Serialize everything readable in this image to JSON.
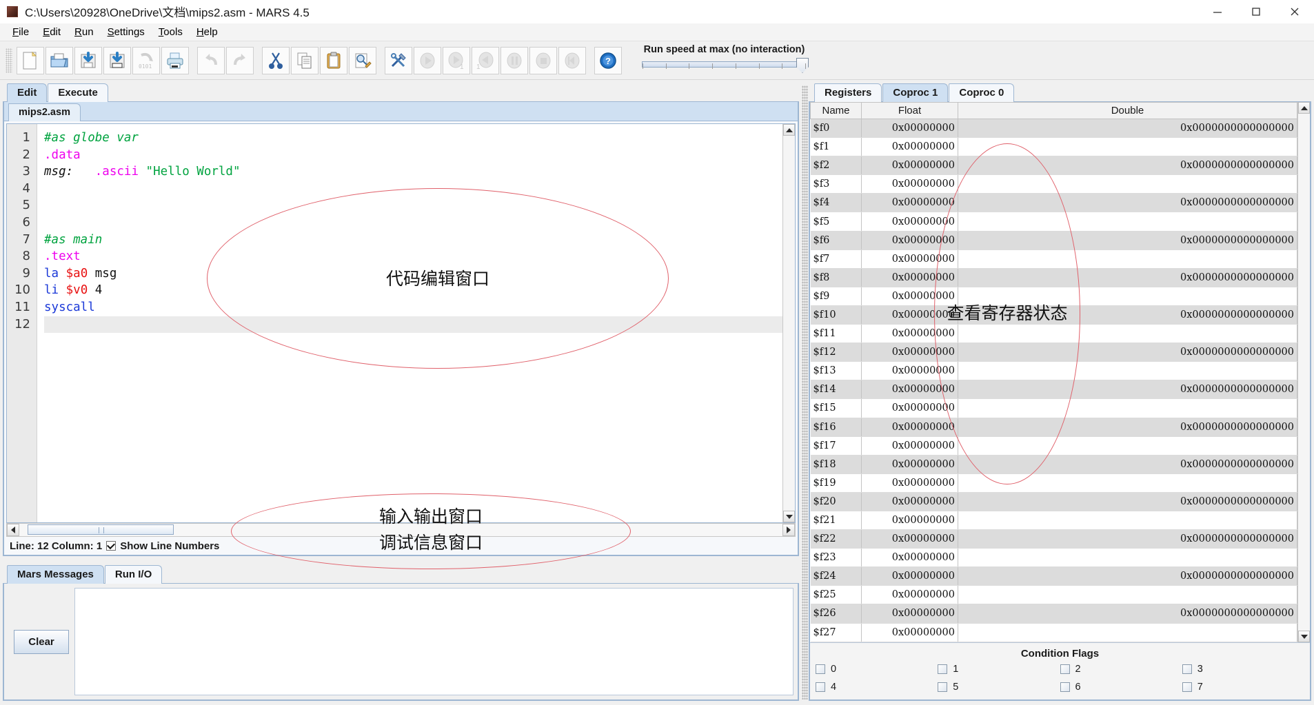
{
  "window": {
    "title": "C:\\Users\\20928\\OneDrive\\文档\\mips2.asm  - MARS 4.5",
    "minimize": "—",
    "maximize": "▢",
    "close": "✕"
  },
  "menu": [
    {
      "label": "File",
      "mnemonic": "F"
    },
    {
      "label": "Edit",
      "mnemonic": "E"
    },
    {
      "label": "Run",
      "mnemonic": "R"
    },
    {
      "label": "Settings",
      "mnemonic": "S"
    },
    {
      "label": "Tools",
      "mnemonic": "T"
    },
    {
      "label": "Help",
      "mnemonic": "H"
    }
  ],
  "toolbar": {
    "buttons": [
      {
        "name": "new-file-icon",
        "enabled": true
      },
      {
        "name": "open-file-icon",
        "enabled": true
      },
      {
        "name": "save-file-icon",
        "enabled": true
      },
      {
        "name": "save-as-file-icon",
        "enabled": true
      },
      {
        "name": "dump-memory-icon",
        "enabled": false
      },
      {
        "name": "print-icon",
        "enabled": true
      },
      {
        "name": "undo-icon",
        "enabled": false
      },
      {
        "name": "redo-icon",
        "enabled": false
      },
      {
        "name": "cut-icon",
        "enabled": true
      },
      {
        "name": "copy-icon",
        "enabled": true
      },
      {
        "name": "paste-icon",
        "enabled": true
      },
      {
        "name": "find-replace-icon",
        "enabled": true
      },
      {
        "name": "assemble-icon",
        "enabled": true
      },
      {
        "name": "run-icon",
        "enabled": false
      },
      {
        "name": "step-icon",
        "enabled": false
      },
      {
        "name": "backstep-icon",
        "enabled": false
      },
      {
        "name": "pause-icon",
        "enabled": false
      },
      {
        "name": "stop-icon",
        "enabled": false
      },
      {
        "name": "reset-icon",
        "enabled": false
      },
      {
        "name": "help-icon",
        "enabled": true
      }
    ],
    "run_speed_label": "Run speed at max (no interaction)"
  },
  "editor": {
    "tabs": [
      {
        "label": "Edit",
        "active": true
      },
      {
        "label": "Execute",
        "active": false
      }
    ],
    "file_tab": "mips2.asm",
    "lines": [
      {
        "num": "1",
        "tokens": [
          {
            "t": "#as globe var",
            "c": "c-comment"
          }
        ]
      },
      {
        "num": "2",
        "tokens": [
          {
            "t": ".data",
            "c": "c-directive"
          }
        ]
      },
      {
        "num": "3",
        "tokens": [
          {
            "t": "msg:",
            "c": "c-label"
          },
          {
            "t": "   ",
            "c": "c-plain"
          },
          {
            "t": ".ascii",
            "c": "c-directive"
          },
          {
            "t": " ",
            "c": "c-plain"
          },
          {
            "t": "\"Hello World\"",
            "c": "c-string"
          }
        ]
      },
      {
        "num": "4",
        "tokens": []
      },
      {
        "num": "5",
        "tokens": []
      },
      {
        "num": "6",
        "tokens": []
      },
      {
        "num": "7",
        "tokens": [
          {
            "t": "#as main",
            "c": "c-comment"
          }
        ]
      },
      {
        "num": "8",
        "tokens": [
          {
            "t": ".text",
            "c": "c-directive"
          }
        ]
      },
      {
        "num": "9",
        "tokens": [
          {
            "t": "la",
            "c": "c-instr"
          },
          {
            "t": " ",
            "c": "c-plain"
          },
          {
            "t": "$a0",
            "c": "c-reg"
          },
          {
            "t": " msg",
            "c": "c-plain"
          }
        ]
      },
      {
        "num": "10",
        "tokens": [
          {
            "t": "li",
            "c": "c-instr"
          },
          {
            "t": " ",
            "c": "c-plain"
          },
          {
            "t": "$v0",
            "c": "c-reg"
          },
          {
            "t": " 4",
            "c": "c-plain"
          }
        ]
      },
      {
        "num": "11",
        "tokens": [
          {
            "t": "syscall",
            "c": "c-instr"
          }
        ]
      },
      {
        "num": "12",
        "tokens": [],
        "current": true
      }
    ],
    "status": {
      "position": "Line: 12 Column: 1",
      "show_line_numbers_label": "Show Line Numbers",
      "show_line_numbers_checked": true
    }
  },
  "messages": {
    "tabs": [
      {
        "label": "Mars Messages",
        "active": true
      },
      {
        "label": "Run I/O",
        "active": false
      }
    ],
    "clear_label": "Clear",
    "content": ""
  },
  "registers": {
    "tabs": [
      {
        "label": "Registers",
        "active": false
      },
      {
        "label": "Coproc 1",
        "active": true
      },
      {
        "label": "Coproc 0",
        "active": false
      }
    ],
    "columns": [
      "Name",
      "Float",
      "Double"
    ],
    "rows": [
      {
        "name": "$f0",
        "float": "0x00000000",
        "double": "0x0000000000000000"
      },
      {
        "name": "$f1",
        "float": "0x00000000",
        "double": ""
      },
      {
        "name": "$f2",
        "float": "0x00000000",
        "double": "0x0000000000000000"
      },
      {
        "name": "$f3",
        "float": "0x00000000",
        "double": ""
      },
      {
        "name": "$f4",
        "float": "0x00000000",
        "double": "0x0000000000000000"
      },
      {
        "name": "$f5",
        "float": "0x00000000",
        "double": ""
      },
      {
        "name": "$f6",
        "float": "0x00000000",
        "double": "0x0000000000000000"
      },
      {
        "name": "$f7",
        "float": "0x00000000",
        "double": ""
      },
      {
        "name": "$f8",
        "float": "0x00000000",
        "double": "0x0000000000000000"
      },
      {
        "name": "$f9",
        "float": "0x00000000",
        "double": ""
      },
      {
        "name": "$f10",
        "float": "0x00000000",
        "double": "0x0000000000000000"
      },
      {
        "name": "$f11",
        "float": "0x00000000",
        "double": ""
      },
      {
        "name": "$f12",
        "float": "0x00000000",
        "double": "0x0000000000000000"
      },
      {
        "name": "$f13",
        "float": "0x00000000",
        "double": ""
      },
      {
        "name": "$f14",
        "float": "0x00000000",
        "double": "0x0000000000000000"
      },
      {
        "name": "$f15",
        "float": "0x00000000",
        "double": ""
      },
      {
        "name": "$f16",
        "float": "0x00000000",
        "double": "0x0000000000000000"
      },
      {
        "name": "$f17",
        "float": "0x00000000",
        "double": ""
      },
      {
        "name": "$f18",
        "float": "0x00000000",
        "double": "0x0000000000000000"
      },
      {
        "name": "$f19",
        "float": "0x00000000",
        "double": ""
      },
      {
        "name": "$f20",
        "float": "0x00000000",
        "double": "0x0000000000000000"
      },
      {
        "name": "$f21",
        "float": "0x00000000",
        "double": ""
      },
      {
        "name": "$f22",
        "float": "0x00000000",
        "double": "0x0000000000000000"
      },
      {
        "name": "$f23",
        "float": "0x00000000",
        "double": ""
      },
      {
        "name": "$f24",
        "float": "0x00000000",
        "double": "0x0000000000000000"
      },
      {
        "name": "$f25",
        "float": "0x00000000",
        "double": ""
      },
      {
        "name": "$f26",
        "float": "0x00000000",
        "double": "0x0000000000000000"
      },
      {
        "name": "$f27",
        "float": "0x00000000",
        "double": ""
      }
    ],
    "condition_flags": {
      "title": "Condition Flags",
      "flags": [
        {
          "label": "0",
          "checked": false
        },
        {
          "label": "1",
          "checked": false
        },
        {
          "label": "2",
          "checked": false
        },
        {
          "label": "3",
          "checked": false
        },
        {
          "label": "4",
          "checked": false
        },
        {
          "label": "5",
          "checked": false
        },
        {
          "label": "6",
          "checked": false
        },
        {
          "label": "7",
          "checked": false
        }
      ]
    }
  },
  "annotations": {
    "color": "#e0606a",
    "editor_label": "代码编辑窗口",
    "registers_label": "查看寄存器状态",
    "io_label_line1": "输入输出窗口",
    "io_label_line2": "调试信息窗口"
  }
}
